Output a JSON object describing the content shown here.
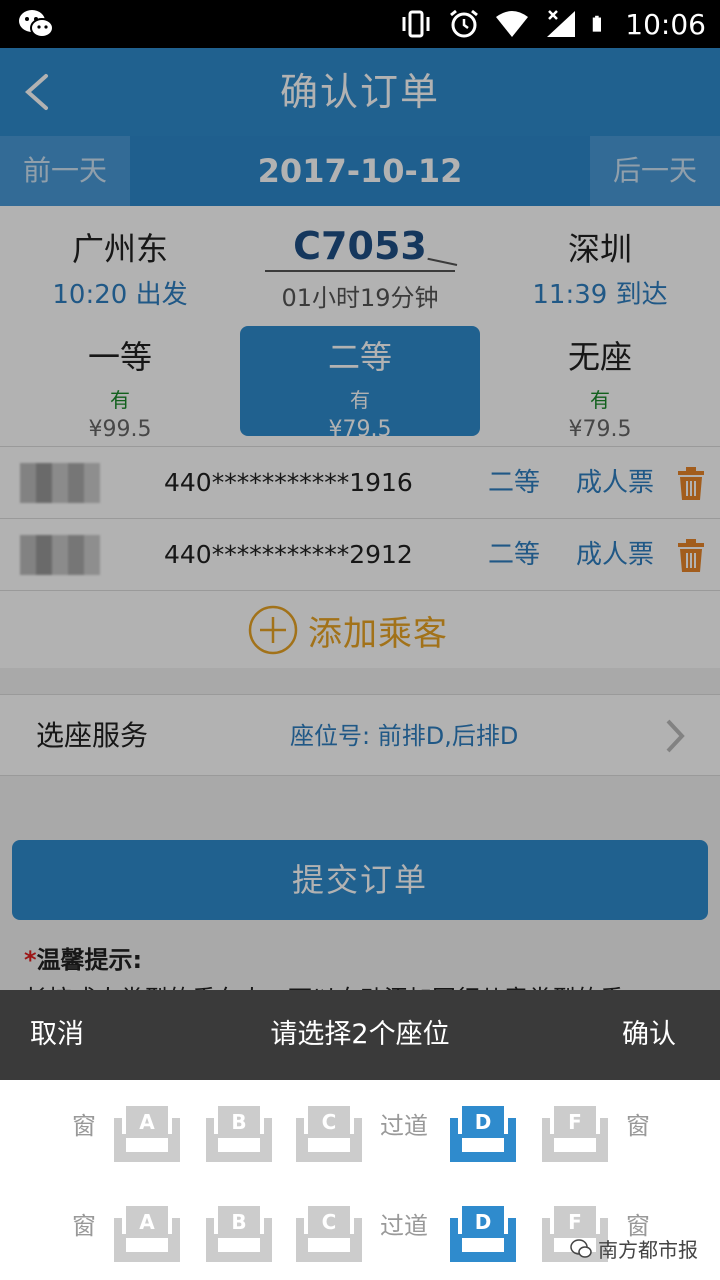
{
  "status_bar": {
    "time": "10:06"
  },
  "header": {
    "title": "确认订单"
  },
  "date_bar": {
    "prev": "前一天",
    "date": "2017-10-12",
    "next": "后一天"
  },
  "train": {
    "from": {
      "station": "广州东",
      "time": "10:20 出发"
    },
    "number": "C7053",
    "duration": "01小时19分钟",
    "to": {
      "station": "深圳",
      "time": "11:39 到达"
    }
  },
  "seat_classes": [
    {
      "name": "一等",
      "availability": "有",
      "price": "¥99.5"
    },
    {
      "name": "二等",
      "availability": "有",
      "price": "¥79.5",
      "selected": true
    },
    {
      "name": "无座",
      "availability": "有",
      "price": "¥79.5"
    }
  ],
  "passengers": [
    {
      "id": "440***********1916",
      "seat": "二等",
      "ticket_type": "成人票"
    },
    {
      "id": "440***********2912",
      "seat": "二等",
      "ticket_type": "成人票"
    }
  ],
  "add_passenger": "添加乘客",
  "seat_service": {
    "label": "选座服务",
    "value": "座位号: 前排D,后排D"
  },
  "submit": "提交订单",
  "tips": {
    "star": "*",
    "title": "温馨提示:",
    "text": "长按成人类型的乘车人，可以自动添加同行儿童类型的乘"
  },
  "picker": {
    "cancel": "取消",
    "title": "请选择2个座位",
    "confirm": "确认",
    "window_label": "窗",
    "aisle_label": "过道",
    "rows": [
      {
        "seats": [
          {
            "letter": "A",
            "selected": false
          },
          {
            "letter": "B",
            "selected": false
          },
          {
            "letter": "C",
            "selected": false
          },
          {
            "letter": "D",
            "selected": true
          },
          {
            "letter": "F",
            "selected": false
          }
        ]
      },
      {
        "seats": [
          {
            "letter": "A",
            "selected": false
          },
          {
            "letter": "B",
            "selected": false
          },
          {
            "letter": "C",
            "selected": false
          },
          {
            "letter": "D",
            "selected": true
          },
          {
            "letter": "F",
            "selected": false
          }
        ]
      }
    ]
  },
  "watermark": "南方都市报",
  "colors": {
    "primary": "#2f8bcd",
    "accent_orange": "#e8a424",
    "available_green": "#1a8a2a",
    "seat_gray": "#cccccc"
  }
}
